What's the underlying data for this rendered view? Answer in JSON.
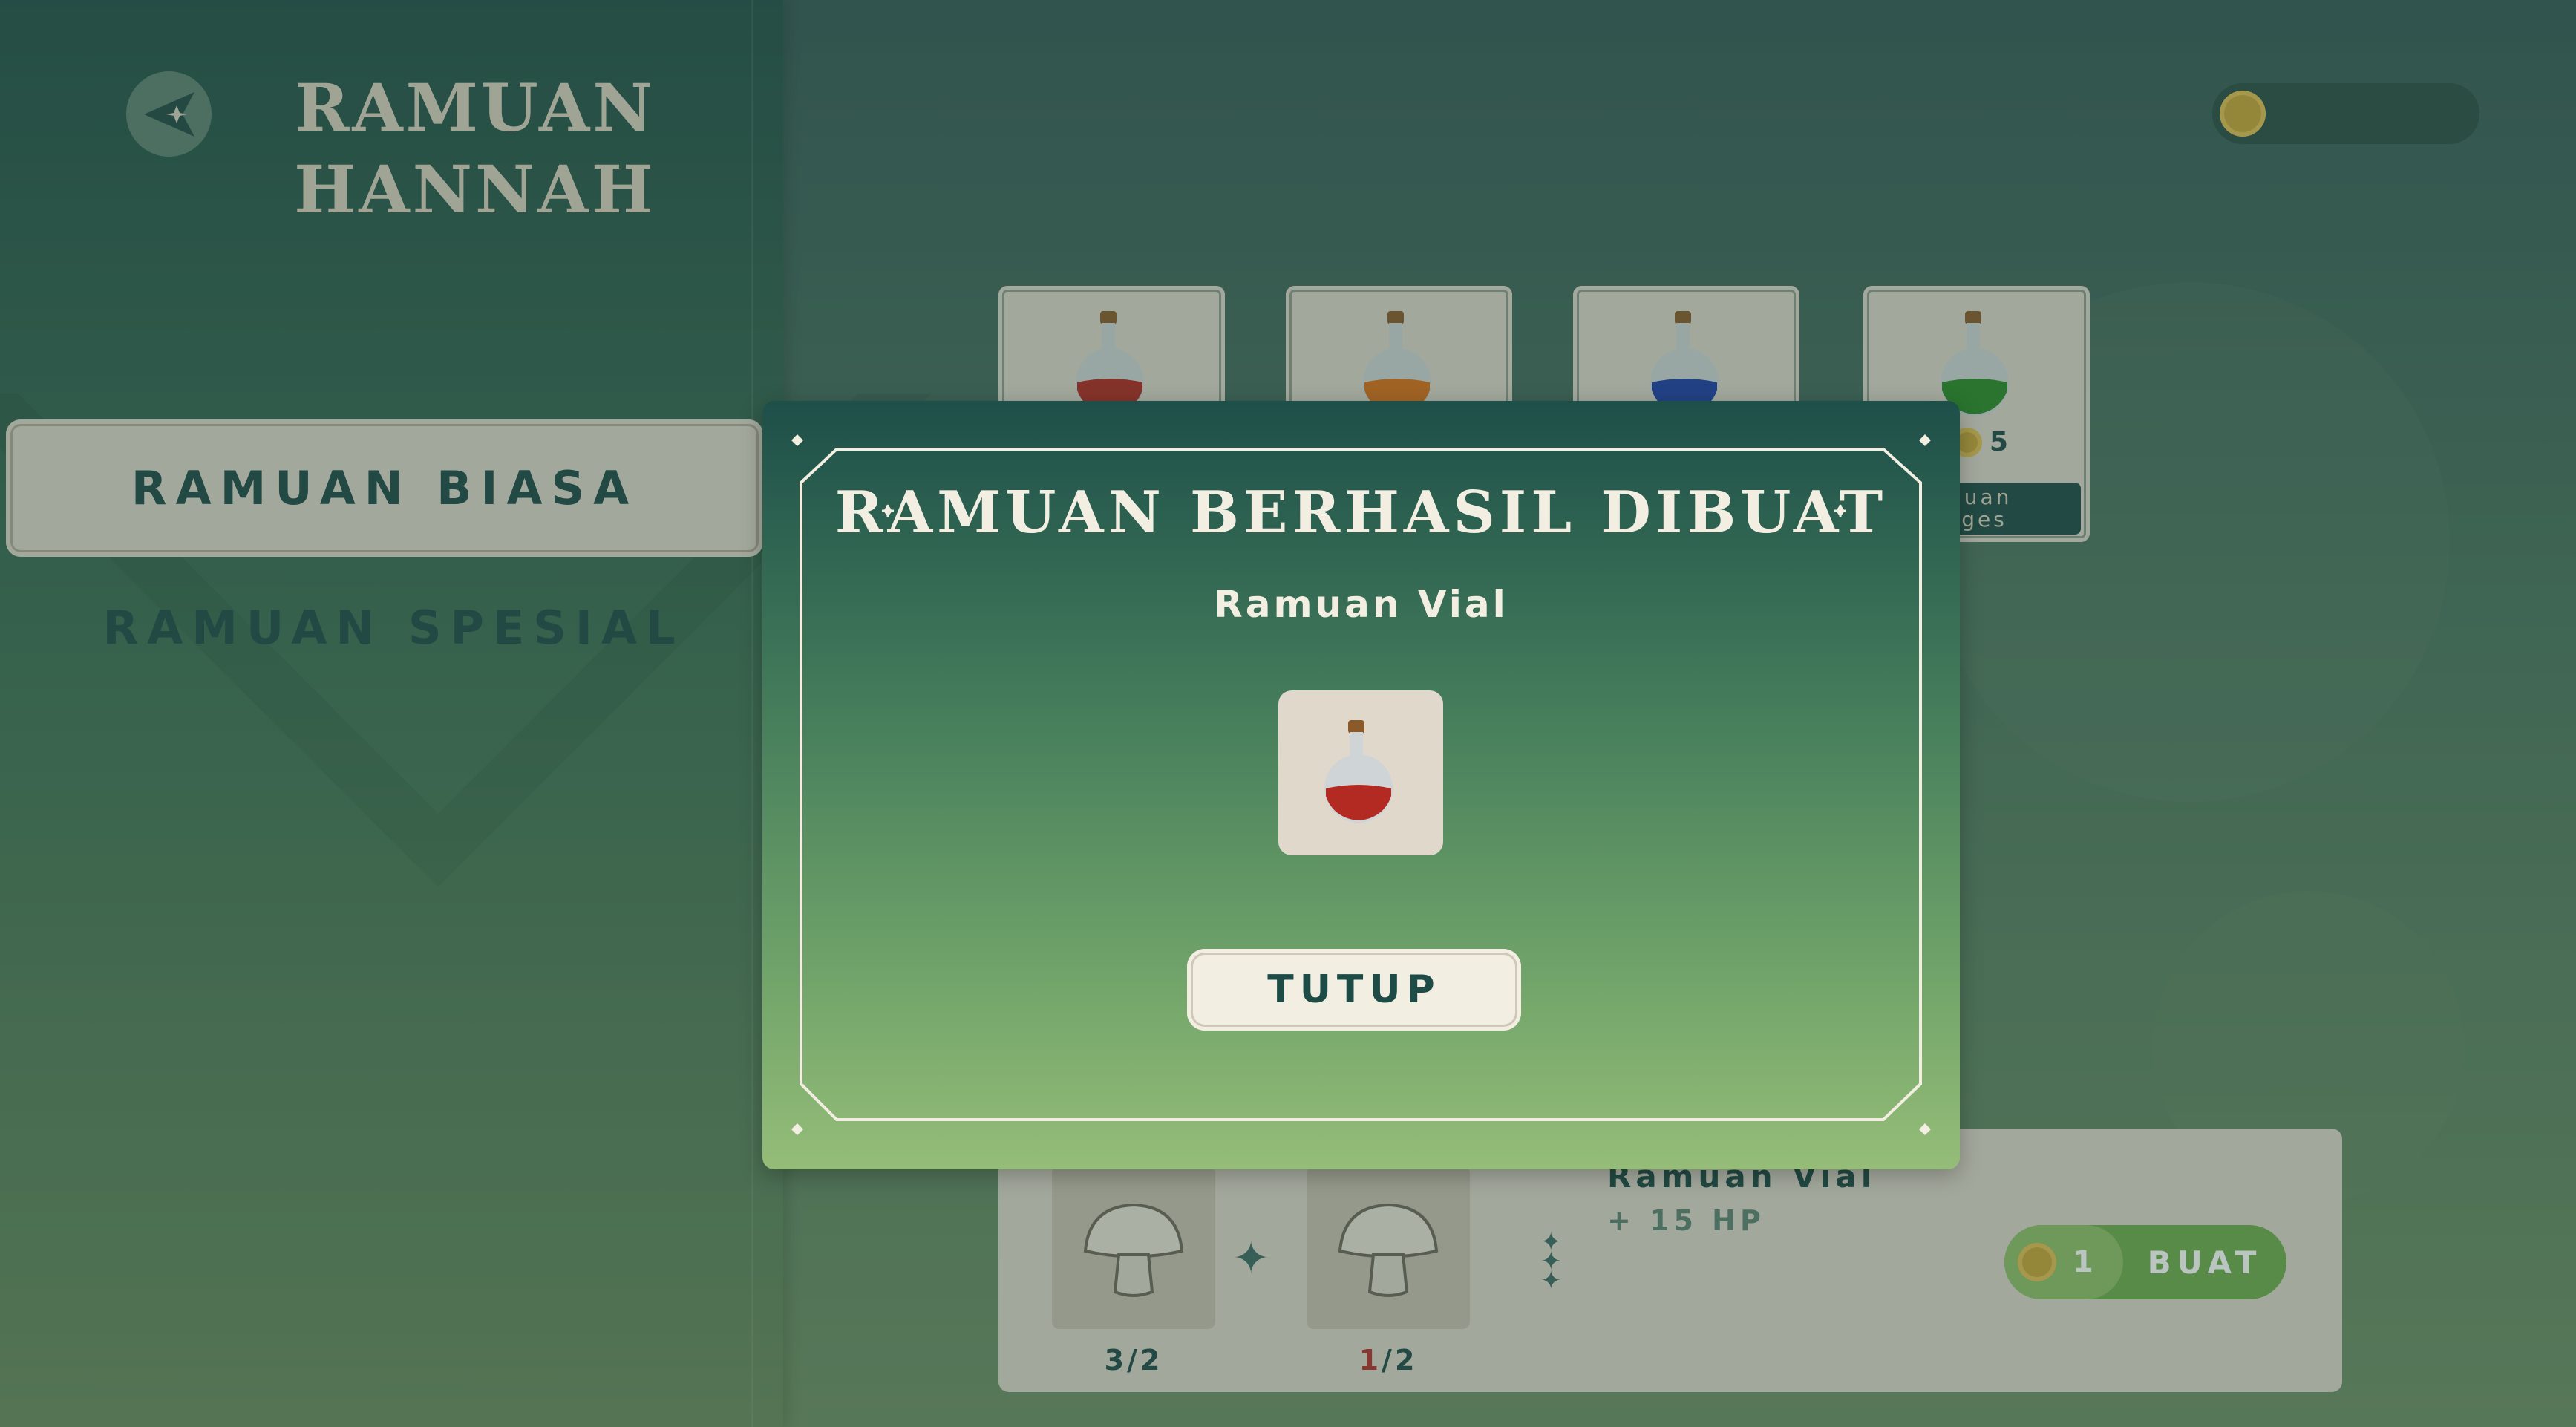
{
  "header": {
    "title_line1": "RAMUAN",
    "title_line2": "HANNAH",
    "back_icon": "back-arrow-star-icon"
  },
  "tabs": [
    {
      "label": "RAMUAN BIASA",
      "active": true
    },
    {
      "label": "RAMUAN SPESIAL",
      "active": false
    }
  ],
  "currency": {
    "icon": "coin-icon",
    "value": ""
  },
  "potion_cards": [
    {
      "color": "#b22a22",
      "icon": "red-potion-icon"
    },
    {
      "color": "#d9701a",
      "icon": "orange-potion-icon"
    },
    {
      "color": "#1f3fa8",
      "icon": "blue-potion-icon"
    },
    {
      "color": "#2c8a2a",
      "icon": "green-potion-icon",
      "price": "5",
      "label_line1": "muan",
      "label_line2": "ages"
    }
  ],
  "recipe": {
    "ingredients": [
      {
        "icon": "mushroom-icon",
        "have": "3",
        "need": "2"
      },
      {
        "icon": "mushroom-icon",
        "have": "1",
        "need": "2"
      }
    ],
    "result_name": "Ramuan Vial",
    "result_stat": "+ 15 HP",
    "craft_cost": "1",
    "craft_label": "BUAT"
  },
  "modal": {
    "title": "RAMUAN BERHASIL DIBUAT",
    "item_name": "Ramuan Vial",
    "item_icon": "red-potion-icon",
    "close_label": "TUTUP"
  },
  "colors": {
    "dark_teal": "#1f4b47",
    "cream": "#ddd6ca",
    "craft_green": "#6fab4e",
    "coin_gold": "#c9a53a",
    "warn_red": "#b4322c"
  }
}
